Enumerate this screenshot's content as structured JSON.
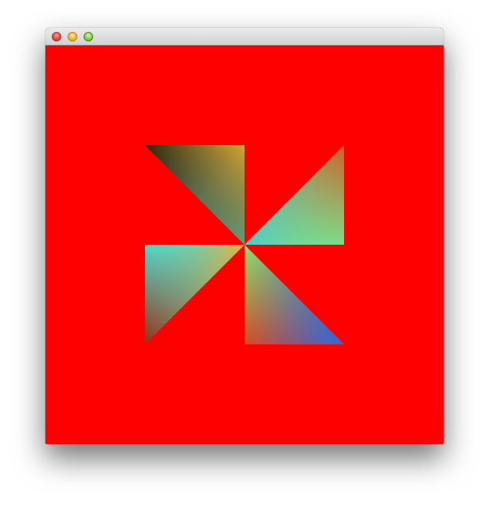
{
  "window": {
    "title": "",
    "background_color": "#ff0000",
    "titlebar_buttons": [
      "close-button",
      "minimize-button",
      "zoom-button"
    ]
  },
  "canvas": {
    "graphic": "pinwheel",
    "blades": [
      {
        "name": "top-left-blade",
        "gradient": [
          "#000000",
          "#e0a030",
          "#5ecfc0"
        ]
      },
      {
        "name": "top-right-blade",
        "gradient": [
          "#d8521c",
          "#5ecfc0",
          "#70e09a"
        ]
      },
      {
        "name": "bottom-left-blade",
        "gradient": [
          "#60d8c0",
          "#e8b030",
          "#9a2a10"
        ]
      },
      {
        "name": "bottom-right-blade",
        "gradient": [
          "#90e070",
          "#d84020",
          "#2a6ae0"
        ]
      }
    ]
  }
}
